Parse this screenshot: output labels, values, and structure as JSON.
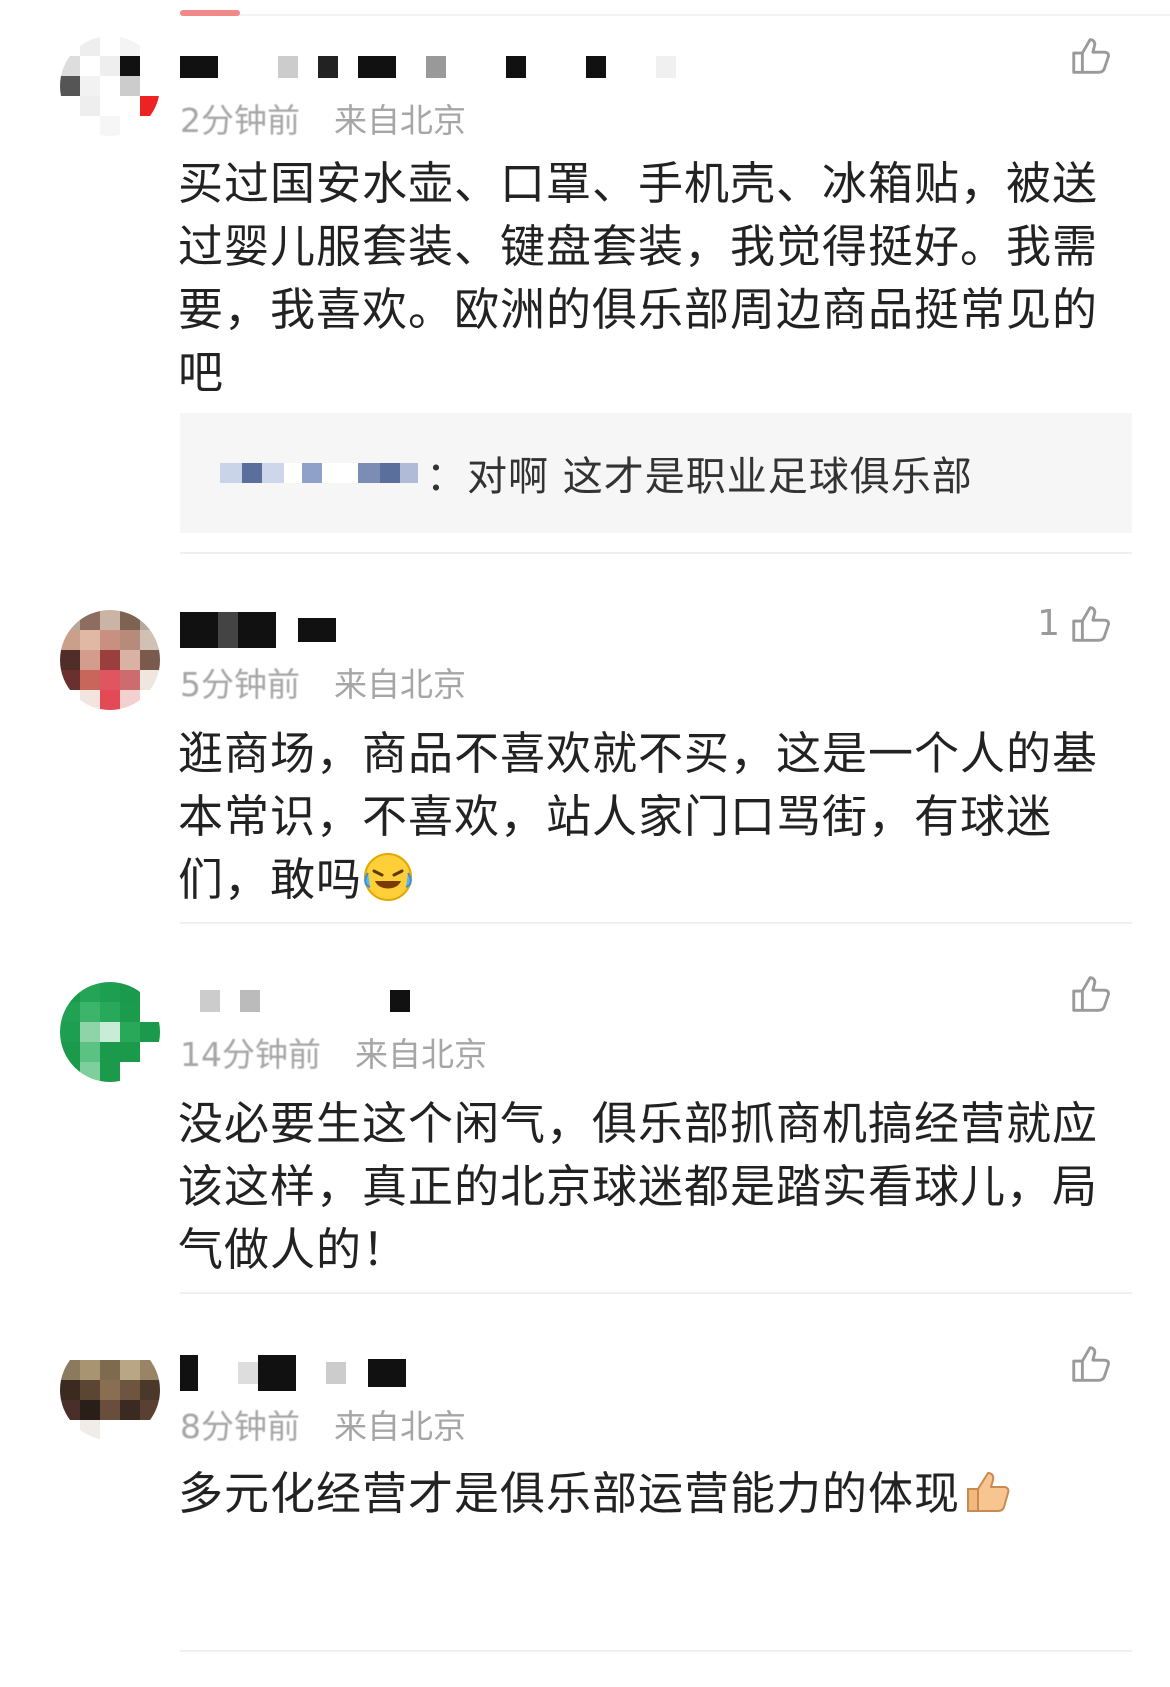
{
  "comments": [
    {
      "time": "2分钟前",
      "location": "来自北京",
      "likes": "",
      "text": "买过国安水壶、口罩、手机壳、冰箱贴，被送过婴儿服套装、键盘套装，我觉得挺好。我需要，我喜欢。欧洲的俱乐部周边商品挺常见的吧",
      "reply": {
        "text": "：对啊 这才是职业足球俱乐部"
      }
    },
    {
      "time": "5分钟前",
      "location": "来自北京",
      "likes": "1",
      "text": "逛商场，商品不喜欢就不买，这是一个人的基本常识，不喜欢，站人家门口骂街，有球迷们，敢吗"
    },
    {
      "time": "14分钟前",
      "location": "来自北京",
      "likes": "",
      "text": "没必要生这个闲气，俱乐部抓商机搞经营就应该这样，真正的北京球迷都是踏实看球儿，局气做人的！"
    },
    {
      "time": "8分钟前",
      "location": "来自北京",
      "likes": "",
      "text": "多元化经营才是俱乐部运营能力的体现"
    }
  ],
  "icons": {
    "like": "thumbs-up-outline-icon",
    "laugh": "laughing-crying-emoji",
    "thumb": "thumbs-up-emoji"
  },
  "colors": {
    "text": "#222222",
    "meta": "#a6a6a6",
    "reply_bg": "#f6f6f6",
    "icon": "#9a9a9a"
  }
}
